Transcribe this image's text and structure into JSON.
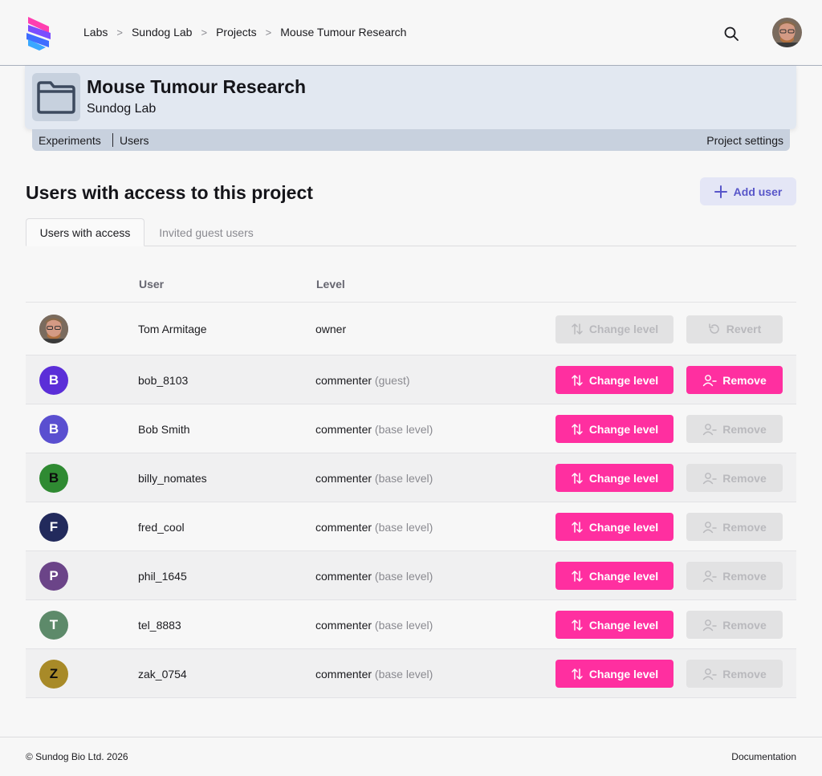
{
  "breadcrumbs": [
    "Labs",
    "Sundog Lab",
    "Projects",
    "Mouse Tumour Research"
  ],
  "project": {
    "title": "Mouse Tumour Research",
    "lab": "Sundog Lab"
  },
  "subnav": {
    "experiments": "Experiments",
    "users": "Users",
    "settings": "Project settings"
  },
  "section": {
    "title": "Users with access to this project",
    "add_user": "Add user"
  },
  "tabs": {
    "active": "Users with access",
    "inactive": "Invited guest users"
  },
  "table": {
    "col_user": "User",
    "col_level": "Level",
    "rows": [
      {
        "initial": "",
        "name": "Tom Armitage",
        "level": "owner",
        "note": "",
        "color": "",
        "enabled": false,
        "remove_label": "Revert"
      },
      {
        "initial": "B",
        "name": "bob_8103",
        "level": "commenter",
        "note": "(guest)",
        "color": "#5b2ed8",
        "enabled": true,
        "remove_label": "Remove"
      },
      {
        "initial": "B",
        "name": "Bob Smith",
        "level": "commenter",
        "note": "(base level)",
        "color": "#5a4fd0",
        "enabled": true,
        "remove_label": "Remove"
      },
      {
        "initial": "B",
        "name": "billy_nomates",
        "level": "commenter",
        "note": "(base level)",
        "color": "#2f8a32",
        "enabled": true,
        "remove_label": "Remove"
      },
      {
        "initial": "F",
        "name": "fred_cool",
        "level": "commenter",
        "note": "(base level)",
        "color": "#222a5c",
        "enabled": true,
        "remove_label": "Remove"
      },
      {
        "initial": "P",
        "name": "phil_1645",
        "level": "commenter",
        "note": "(base level)",
        "color": "#6b4488",
        "enabled": true,
        "remove_label": "Remove"
      },
      {
        "initial": "T",
        "name": "tel_8883",
        "level": "commenter",
        "note": "(base level)",
        "color": "#5d8a6a",
        "enabled": true,
        "remove_label": "Remove"
      },
      {
        "initial": "Z",
        "name": "zak_0754",
        "level": "commenter",
        "note": "(base level)",
        "color": "#a88a28",
        "enabled": true,
        "remove_label": "Remove"
      }
    ],
    "change_label": "Change level"
  },
  "footer": {
    "copyright": "© Sundog Bio Ltd. 2026",
    "docs": "Documentation"
  },
  "colors": {
    "accent_pink": "#ff2fa0",
    "add_user_text": "#5856c9",
    "banner": "#e2e8f1"
  }
}
